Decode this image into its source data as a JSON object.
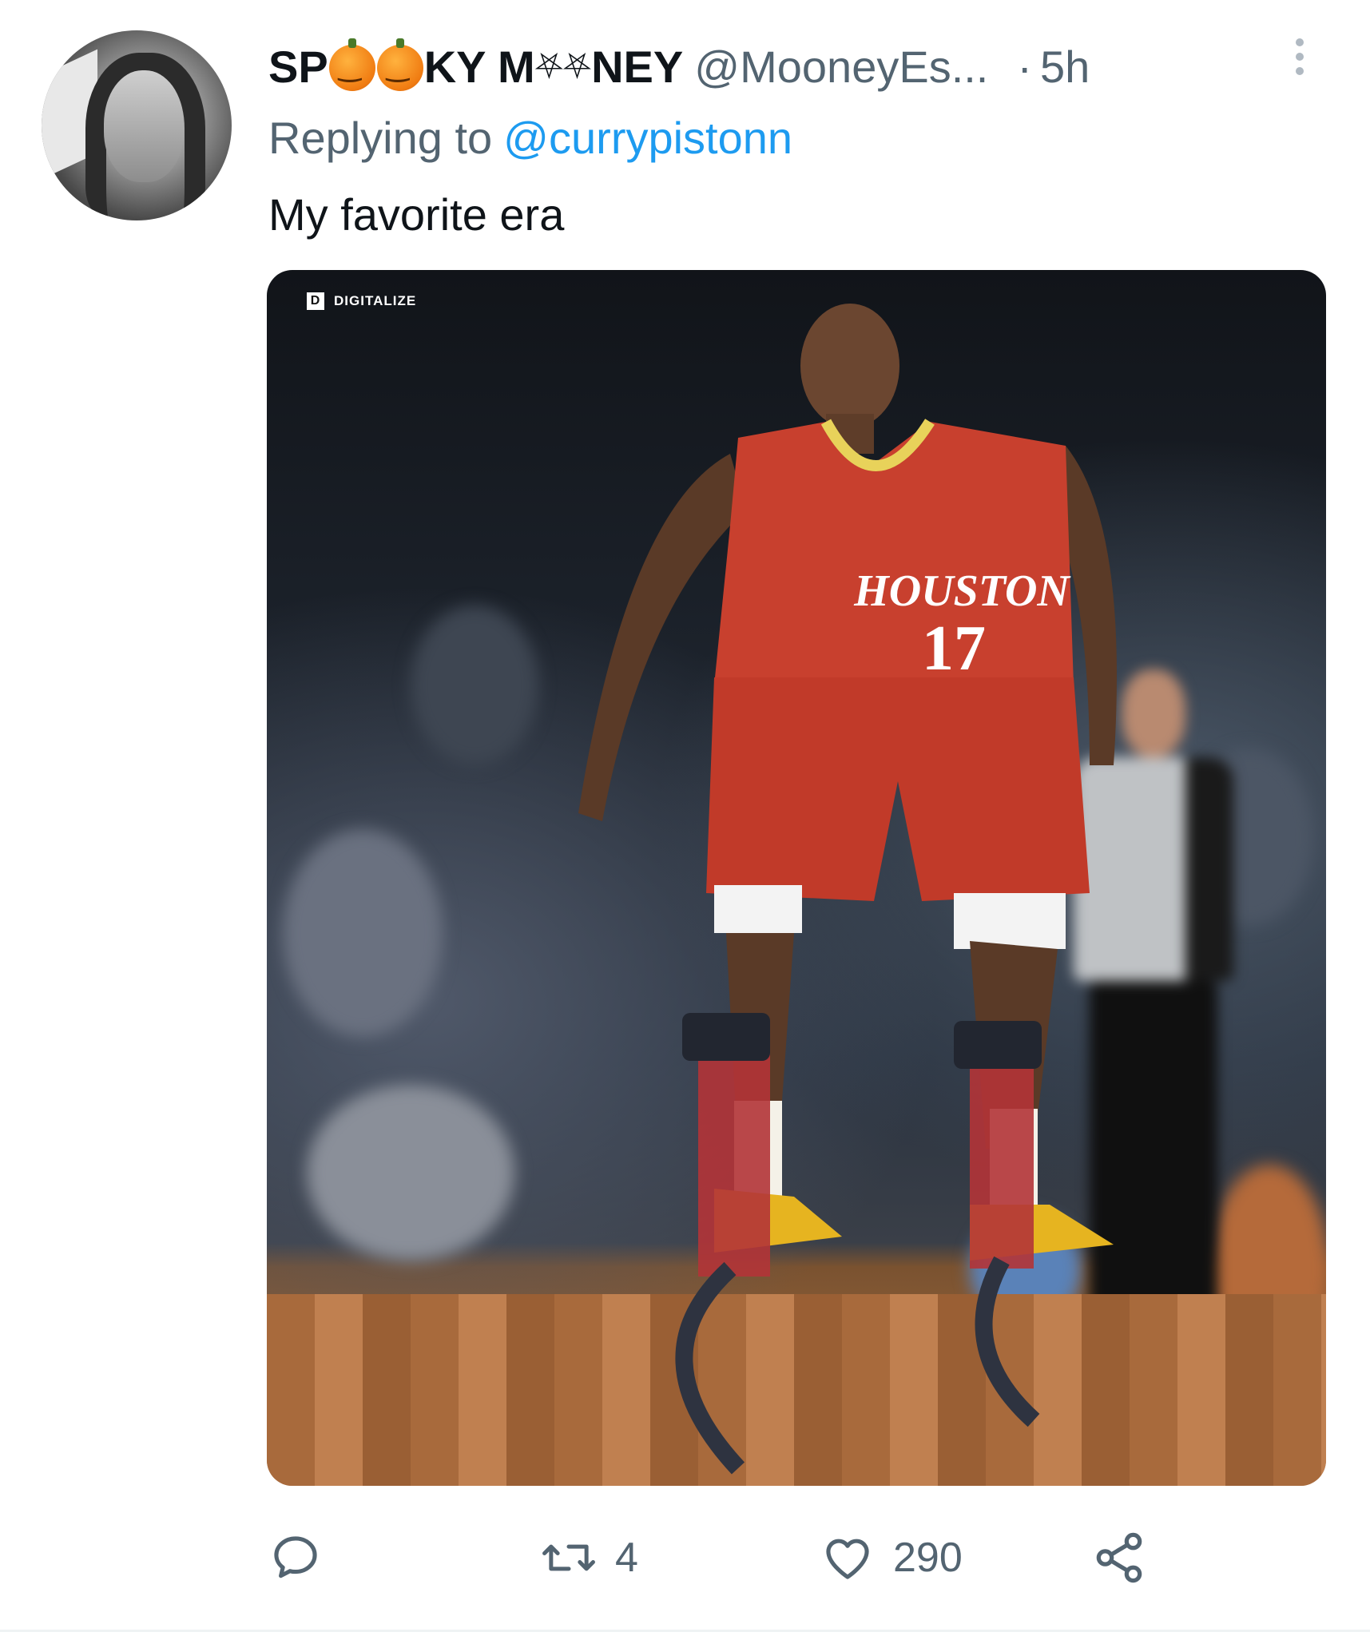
{
  "tweet": {
    "author": {
      "name_parts": [
        "SP",
        "KY M",
        "NEY"
      ],
      "name_glyphs": [
        "⛧",
        "⛧"
      ],
      "handle": "@MooneyEs...",
      "separator": "·",
      "time": "5h"
    },
    "replying_prefix": "Replying to",
    "replying_to": "@currypistonn",
    "text": "My favorite era",
    "media": {
      "watermark": "DIGITALIZE",
      "watermark_logo": "D",
      "jersey_text": "HOUSTON",
      "jersey_number": "17"
    },
    "actions": {
      "reply_icon": "speech-bubble-icon",
      "retweet_icon": "retweet-icon",
      "retweet_count": "4",
      "like_icon": "heart-icon",
      "like_count": "290",
      "share_icon": "share-icon"
    }
  },
  "colors": {
    "link": "#1d9bf0",
    "secondary_text": "#536471",
    "primary_text": "#0f1419",
    "jersey_red": "#c8402e"
  }
}
